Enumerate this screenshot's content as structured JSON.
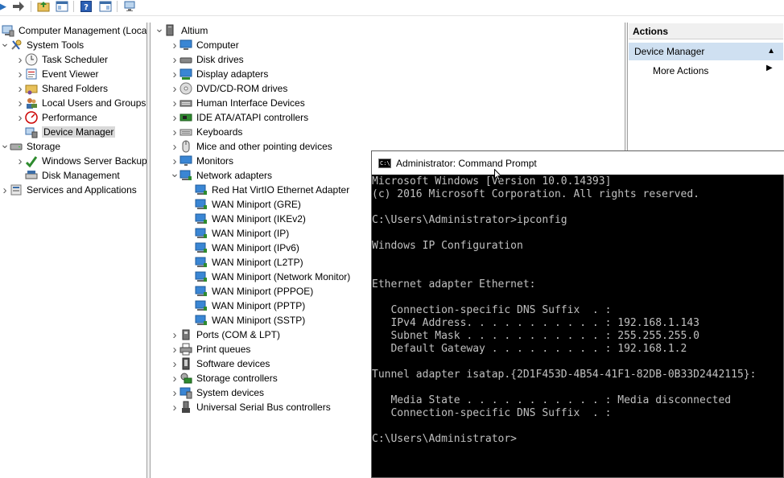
{
  "toolbar": {
    "icons": [
      "forward-arrow-icon",
      "up-folder-icon",
      "show-hide-tree-icon",
      "help-icon",
      "properties-icon",
      "monitor-icon"
    ]
  },
  "left_tree": [
    {
      "label": "Computer Management (Local",
      "level": 0,
      "arrow": "",
      "icon": "computer-management-icon"
    },
    {
      "label": "System Tools",
      "level": 1,
      "arrow": "v",
      "icon": "tools-icon"
    },
    {
      "label": "Task Scheduler",
      "level": 2,
      "arrow": ">",
      "icon": "clock-icon"
    },
    {
      "label": "Event Viewer",
      "level": 2,
      "arrow": ">",
      "icon": "event-viewer-icon"
    },
    {
      "label": "Shared Folders",
      "level": 2,
      "arrow": ">",
      "icon": "shared-folder-icon"
    },
    {
      "label": "Local Users and Groups",
      "level": 2,
      "arrow": ">",
      "icon": "users-icon"
    },
    {
      "label": "Performance",
      "level": 2,
      "arrow": ">",
      "icon": "performance-icon"
    },
    {
      "label": "Device Manager",
      "level": 2,
      "arrow": "",
      "icon": "device-manager-icon",
      "selected": true
    },
    {
      "label": "Storage",
      "level": 1,
      "arrow": "v",
      "icon": "storage-icon"
    },
    {
      "label": "Windows Server Backup",
      "level": 2,
      "arrow": ">",
      "icon": "backup-icon"
    },
    {
      "label": "Disk Management",
      "level": 2,
      "arrow": "",
      "icon": "disk-management-icon"
    },
    {
      "label": "Services and Applications",
      "level": 1,
      "arrow": ">",
      "icon": "services-icon"
    }
  ],
  "device_tree": {
    "root": "Altium",
    "items": [
      {
        "label": "Computer",
        "arrow": ">",
        "icon": "computer-icon"
      },
      {
        "label": "Disk drives",
        "arrow": ">",
        "icon": "disk-drive-icon"
      },
      {
        "label": "Display adapters",
        "arrow": ">",
        "icon": "display-adapter-icon"
      },
      {
        "label": "DVD/CD-ROM drives",
        "arrow": ">",
        "icon": "dvd-icon"
      },
      {
        "label": "Human Interface Devices",
        "arrow": ">",
        "icon": "hid-icon"
      },
      {
        "label": "IDE ATA/ATAPI controllers",
        "arrow": ">",
        "icon": "ide-controller-icon"
      },
      {
        "label": "Keyboards",
        "arrow": ">",
        "icon": "keyboard-icon"
      },
      {
        "label": "Mice and other pointing devices",
        "arrow": ">",
        "icon": "mouse-icon"
      },
      {
        "label": "Monitors",
        "arrow": ">",
        "icon": "monitor-icon"
      },
      {
        "label": "Network adapters",
        "arrow": "v",
        "icon": "network-adapter-icon"
      },
      {
        "label": "Red Hat VirtIO Ethernet Adapter",
        "child": true,
        "icon": "network-adapter-icon"
      },
      {
        "label": "WAN Miniport (GRE)",
        "child": true,
        "icon": "network-adapter-icon"
      },
      {
        "label": "WAN Miniport (IKEv2)",
        "child": true,
        "icon": "network-adapter-icon"
      },
      {
        "label": "WAN Miniport (IP)",
        "child": true,
        "icon": "network-adapter-icon"
      },
      {
        "label": "WAN Miniport (IPv6)",
        "child": true,
        "icon": "network-adapter-icon"
      },
      {
        "label": "WAN Miniport (L2TP)",
        "child": true,
        "icon": "network-adapter-icon"
      },
      {
        "label": "WAN Miniport (Network Monitor)",
        "child": true,
        "icon": "network-adapter-icon"
      },
      {
        "label": "WAN Miniport (PPPOE)",
        "child": true,
        "icon": "network-adapter-icon"
      },
      {
        "label": "WAN Miniport (PPTP)",
        "child": true,
        "icon": "network-adapter-icon"
      },
      {
        "label": "WAN Miniport (SSTP)",
        "child": true,
        "icon": "network-adapter-icon"
      },
      {
        "label": "Ports (COM & LPT)",
        "arrow": ">",
        "icon": "port-icon"
      },
      {
        "label": "Print queues",
        "arrow": ">",
        "icon": "printer-icon"
      },
      {
        "label": "Software devices",
        "arrow": ">",
        "icon": "software-device-icon"
      },
      {
        "label": "Storage controllers",
        "arrow": ">",
        "icon": "storage-controller-icon"
      },
      {
        "label": "System devices",
        "arrow": ">",
        "icon": "system-device-icon"
      },
      {
        "label": "Universal Serial Bus controllers",
        "arrow": ">",
        "icon": "usb-icon"
      }
    ]
  },
  "actions": {
    "header": "Actions",
    "section": "Device Manager",
    "more": "More Actions"
  },
  "cmd": {
    "title": "Administrator: Command Prompt",
    "lines": [
      "Microsoft Windows [Version 10.0.14393]",
      "(c) 2016 Microsoft Corporation. All rights reserved.",
      "",
      "C:\\Users\\Administrator>ipconfig",
      "",
      "Windows IP Configuration",
      "",
      "",
      "Ethernet adapter Ethernet:",
      "",
      "   Connection-specific DNS Suffix  . :",
      "   IPv4 Address. . . . . . . . . . . : 192.168.1.143",
      "   Subnet Mask . . . . . . . . . . . : 255.255.255.0",
      "   Default Gateway . . . . . . . . . : 192.168.1.2",
      "",
      "Tunnel adapter isatap.{2D1F453D-4B54-41F1-82DB-0B33D2442115}:",
      "",
      "   Media State . . . . . . . . . . . : Media disconnected",
      "   Connection-specific DNS Suffix  . :",
      "",
      "C:\\Users\\Administrator>"
    ]
  },
  "colors": {
    "selection": "#d9d9d9",
    "actions_section_bg": "#cfe0f1",
    "cmd_text": "#c0c0c0",
    "cmd_bg": "#000000"
  }
}
